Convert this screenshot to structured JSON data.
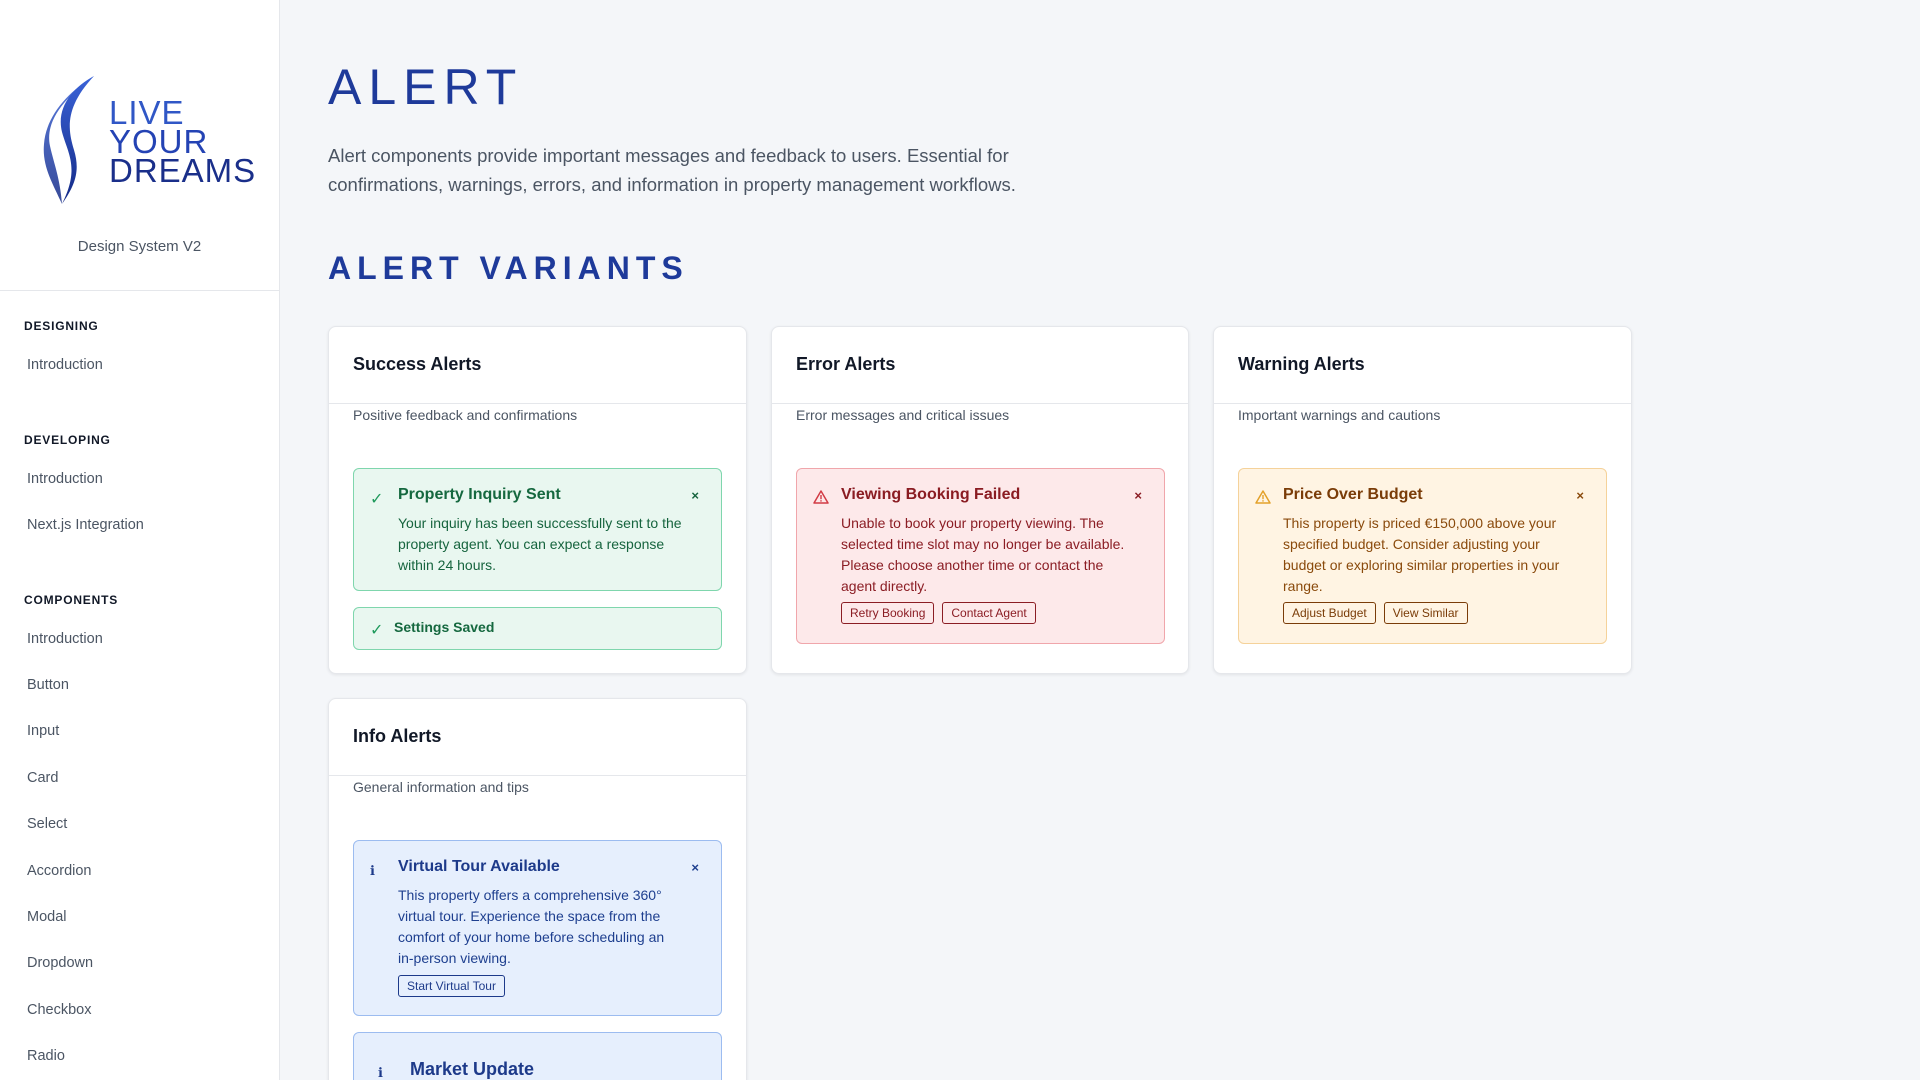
{
  "sidebar": {
    "logo": {
      "line1": "LIVE",
      "line2": "YOUR",
      "line3": "DREAMS"
    },
    "version": "Design System V2",
    "sections": [
      {
        "title": "DESIGNING",
        "items": [
          "Introduction"
        ]
      },
      {
        "title": "DEVELOPING",
        "items": [
          "Introduction",
          "Next.js Integration"
        ]
      },
      {
        "title": "COMPONENTS",
        "items": [
          "Introduction",
          "Button",
          "Input",
          "Card",
          "Select",
          "Accordion",
          "Modal",
          "Dropdown",
          "Checkbox",
          "Radio"
        ]
      }
    ]
  },
  "main": {
    "title": "ALERT",
    "description": "Alert components provide important messages and feedback to users. Essential for confirmations, warnings, errors, and information in property management workflows.",
    "section_title": "ALERT VARIANTS",
    "cards": {
      "success": {
        "title": "Success Alerts",
        "subtitle": "Positive feedback and confirmations",
        "alerts": [
          {
            "title": "Property Inquiry Sent",
            "body": "Your inquiry has been successfully sent to the property agent. You can expect a response within 24 hours.",
            "close": "×"
          },
          {
            "title": "Settings Saved"
          }
        ]
      },
      "error": {
        "title": "Error Alerts",
        "subtitle": "Error messages and critical issues",
        "alerts": [
          {
            "title": "Viewing Booking Failed",
            "body": "Unable to book your property viewing. The selected time slot may no longer be available. Please choose another time or contact the agent directly.",
            "close": "×",
            "actions": [
              "Retry Booking",
              "Contact Agent"
            ]
          }
        ]
      },
      "warning": {
        "title": "Warning Alerts",
        "subtitle": "Important warnings and cautions",
        "alerts": [
          {
            "title": "Price Over Budget",
            "body": "This property is priced €150,000 above your specified budget. Consider adjusting your budget or exploring similar properties in your range.",
            "close": "×",
            "actions": [
              "Adjust Budget",
              "View Similar"
            ]
          }
        ]
      },
      "info": {
        "title": "Info Alerts",
        "subtitle": "General information and tips",
        "alerts": [
          {
            "title": "Virtual Tour Available",
            "body": "This property offers a comprehensive 360° virtual tour. Experience the space from the comfort of your home before scheduling an in-person viewing.",
            "close": "×",
            "actions": [
              "Start Virtual Tour"
            ]
          },
          {
            "title": "Market Update"
          }
        ]
      }
    }
  },
  "icons": {
    "success": "check-icon",
    "error": "alert-triangle-icon",
    "warning": "warning-triangle-icon",
    "info": "info-icon",
    "close": "close-icon"
  },
  "colors": {
    "brand": "#1e3a9a",
    "success": "#1f9a5c",
    "error": "#d23b45",
    "warning": "#e3a12a",
    "info": "#1d3a8a"
  }
}
